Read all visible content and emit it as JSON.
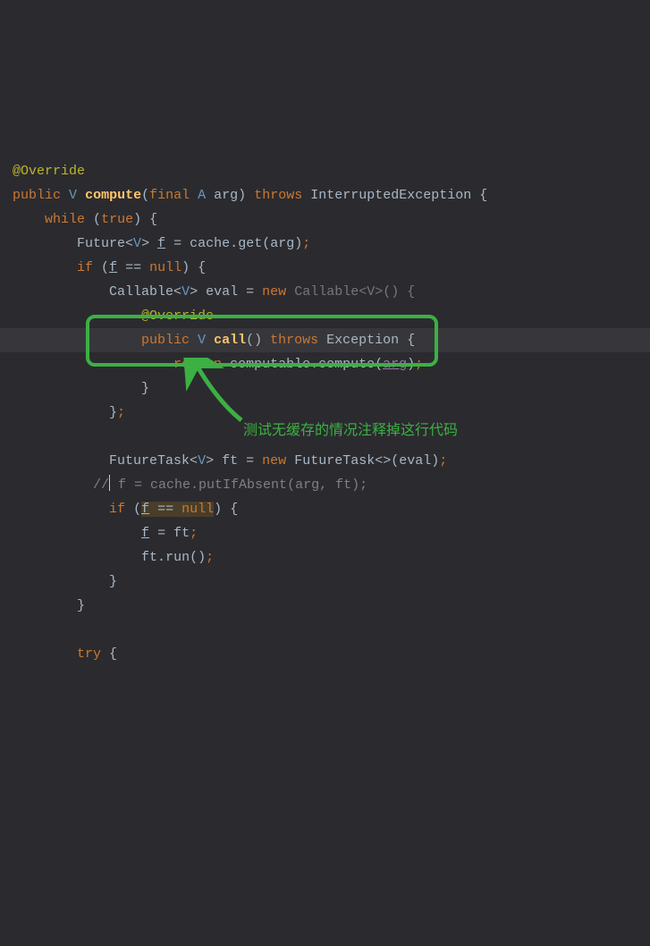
{
  "code": {
    "l1_ann": "@Override",
    "l2_public": "public",
    "l2_V": "V",
    "l2_compute": "compute",
    "l2_open": "(",
    "l2_final": "final",
    "l2_A": "A",
    "l2_arg": "arg",
    "l2_close": ")",
    "l2_throws": "throws",
    "l2_exc": "InterruptedException",
    "l2_brace": "{",
    "l3_while": "while",
    "l3_open": "(",
    "l3_true": "true",
    "l3_close": ")",
    "l3_brace": "{",
    "l4_Future": "Future",
    "l4_lt": "<",
    "l4_V": "V",
    "l4_gt": ">",
    "l4_f": "f",
    "l4_eq": "=",
    "l4_cache": "cache",
    "l4_dot": ".",
    "l4_get": "get",
    "l4_open": "(",
    "l4_arg": "arg",
    "l4_close": ")",
    "l4_semi": ";",
    "l5_if": "if",
    "l5_open": "(",
    "l5_f": "f",
    "l5_eqeq": "==",
    "l5_null": "null",
    "l5_close": ")",
    "l5_brace": "{",
    "l6_Callable": "Callable",
    "l6_lt": "<",
    "l6_V": "V",
    "l6_gt": ">",
    "l6_eval": "eval",
    "l6_eq": "=",
    "l6_new": "new",
    "l6_Callable2": "Callable",
    "l6_lt2": "<",
    "l6_V2": "V",
    "l6_gt2": ">",
    "l6_paren": "()",
    "l6_brace": "{",
    "l7_ann": "@Override",
    "l8_public": "public",
    "l8_V": "V",
    "l8_call": "call",
    "l8_paren": "()",
    "l8_throws": "throws",
    "l8_Exc": "Exception",
    "l8_brace": "{",
    "l9_return": "return",
    "l9_computable": "computable",
    "l9_dot": ".",
    "l9_compute": "compute",
    "l9_open": "(",
    "l9_arg": "arg",
    "l9_close": ")",
    "l9_semi": ";",
    "l10_brace": "}",
    "l11_brace": "}",
    "l11_semi": ";",
    "l13_FutureTask": "FutureTask",
    "l13_lt": "<",
    "l13_V": "V",
    "l13_gt": ">",
    "l13_ft": "ft",
    "l13_eq": "=",
    "l13_new": "new",
    "l13_FutureTask2": "FutureTask",
    "l13_diamond": "<>",
    "l13_open": "(",
    "l13_eval": "eval",
    "l13_close": ")",
    "l13_semi": ";",
    "l14_comment_pre": "//",
    "l14_comment_post": " f = cache.putIfAbsent(arg, ft);",
    "l15_if": "if",
    "l15_open": "(",
    "l15_f": "f",
    "l15_eqeq": "==",
    "l15_null": "null",
    "l15_close": ")",
    "l15_brace": "{",
    "l16_f": "f",
    "l16_eq": "=",
    "l16_ft": "ft",
    "l16_semi": ";",
    "l17_ft": "ft",
    "l17_dot": ".",
    "l17_run": "run",
    "l17_paren": "()",
    "l17_semi": ";",
    "l18_brace": "}",
    "l19_brace": "}",
    "l21_try": "try",
    "l21_brace": "{"
  },
  "annotation": {
    "text": "测试无缓存的情况注释掉这行代码"
  }
}
